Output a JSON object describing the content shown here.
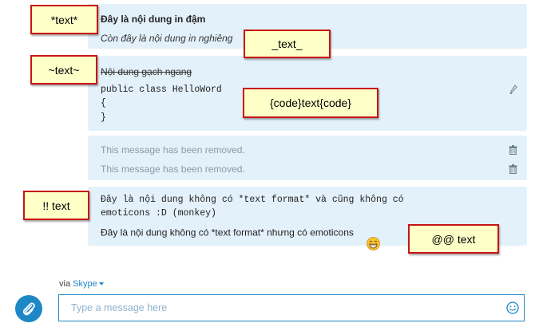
{
  "messages": [
    {
      "lines": [
        "Đây là nội dung in đậm",
        "Còn đây là nội dung in nghiêng"
      ]
    },
    {
      "lines": [
        "Nội dung gạch ngang",
        "public class HelloWord",
        "{",
        "}"
      ]
    },
    {
      "lines": [
        "This message has been removed.",
        "This message has been removed."
      ]
    },
    {
      "lines": [
        "Đây là nội dung không có *text format* và cũng không có",
        "emoticons :D (monkey)",
        "Đây là nội dung không có *text format* nhưng có emoticons"
      ]
    }
  ],
  "annotations": [
    "*text*",
    "_text_",
    "~text~",
    "{code}text{code}",
    "!! text",
    "@@ text"
  ],
  "footer": {
    "via_prefix": "via",
    "via_link": "Skype"
  },
  "input": {
    "placeholder": "Type a message here"
  },
  "icons": {
    "attach": "paperclip-icon",
    "emoticon": "smiley-icon",
    "delete": "trash-icon",
    "edit": "pencil-icon"
  },
  "colors": {
    "bubble": "#e3f1fa",
    "accent": "#1e88c7",
    "annotation_border": "#c81414",
    "annotation_bg": "#ffffc8"
  }
}
